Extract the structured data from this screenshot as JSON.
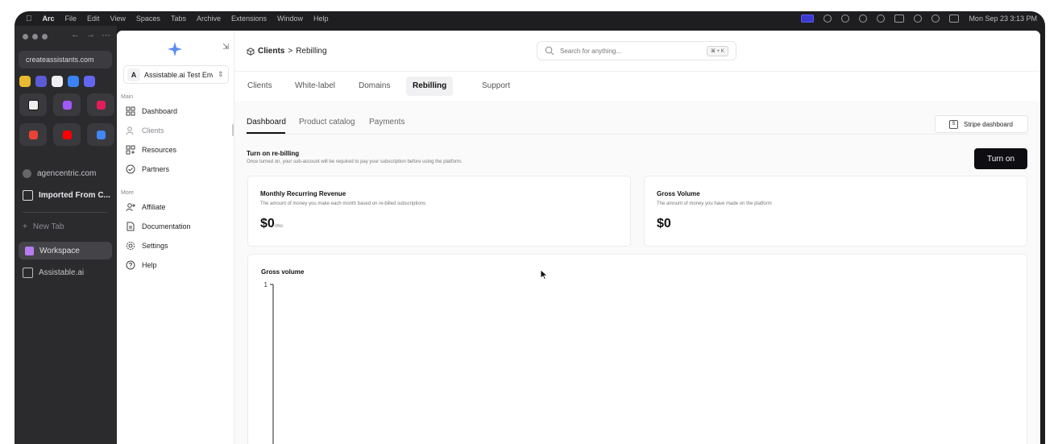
{
  "menubar": {
    "app": "Arc",
    "items": [
      "File",
      "Edit",
      "View",
      "Spaces",
      "Tabs",
      "Archive",
      "Extensions",
      "Window",
      "Help"
    ],
    "clock": "Mon Sep 23  3:13 PM"
  },
  "arc_sidebar": {
    "url": "createassistants.com",
    "items": {
      "agencentric": "agencentric.com",
      "imported": "Imported From C...",
      "new_tab": "New Tab",
      "workspace": "Workspace",
      "assistable": "Assistable.ai"
    }
  },
  "sidebar": {
    "workspace_badge": "A",
    "workspace_name": "Assistable.ai Test Env",
    "section_main": "Main",
    "section_more": "More",
    "items": [
      {
        "label": "Dashboard",
        "icon": "grid-icon"
      },
      {
        "label": "Clients",
        "icon": "users-icon"
      },
      {
        "label": "Resources",
        "icon": "grid-plus-icon"
      },
      {
        "label": "Partners",
        "icon": "check-circle-icon"
      },
      {
        "label": "Affiliate",
        "icon": "user-plus-icon"
      },
      {
        "label": "Documentation",
        "icon": "document-icon"
      },
      {
        "label": "Settings",
        "icon": "gear-icon"
      },
      {
        "label": "Help",
        "icon": "help-icon"
      }
    ]
  },
  "header": {
    "breadcrumb_root": "Clients",
    "breadcrumb_sep": ">",
    "breadcrumb_current": "Rebilling",
    "search_placeholder": "Search for anything...",
    "search_shortcut": "⌘ + K"
  },
  "tabs": [
    "Clients",
    "White-label",
    "Domains",
    "Rebilling",
    "Support"
  ],
  "active_tab": "Rebilling",
  "subtabs": [
    "Dashboard",
    "Product catalog",
    "Payments"
  ],
  "active_subtab": "Dashboard",
  "stripe_button": "Stripe dashboard",
  "rebilling": {
    "title": "Turn on re-billing",
    "description": "Once turned on, your sub-account will be required to pay your subscription before using the platform.",
    "button": "Turn on"
  },
  "cards": {
    "mrr": {
      "title": "Monthly Recurring Revenue",
      "description": "The amount of money you make each month based on re-billed subscriptions",
      "value": "$0",
      "unit": "/mo"
    },
    "gross": {
      "title": "Gross Volume",
      "description": "The amount of money you have made on the platform",
      "value": "$0"
    }
  },
  "chart_data": {
    "type": "line",
    "title": "Gross volume",
    "x": [],
    "series": [],
    "y_ticks": [
      "1"
    ],
    "ylim": [
      0,
      1
    ]
  }
}
